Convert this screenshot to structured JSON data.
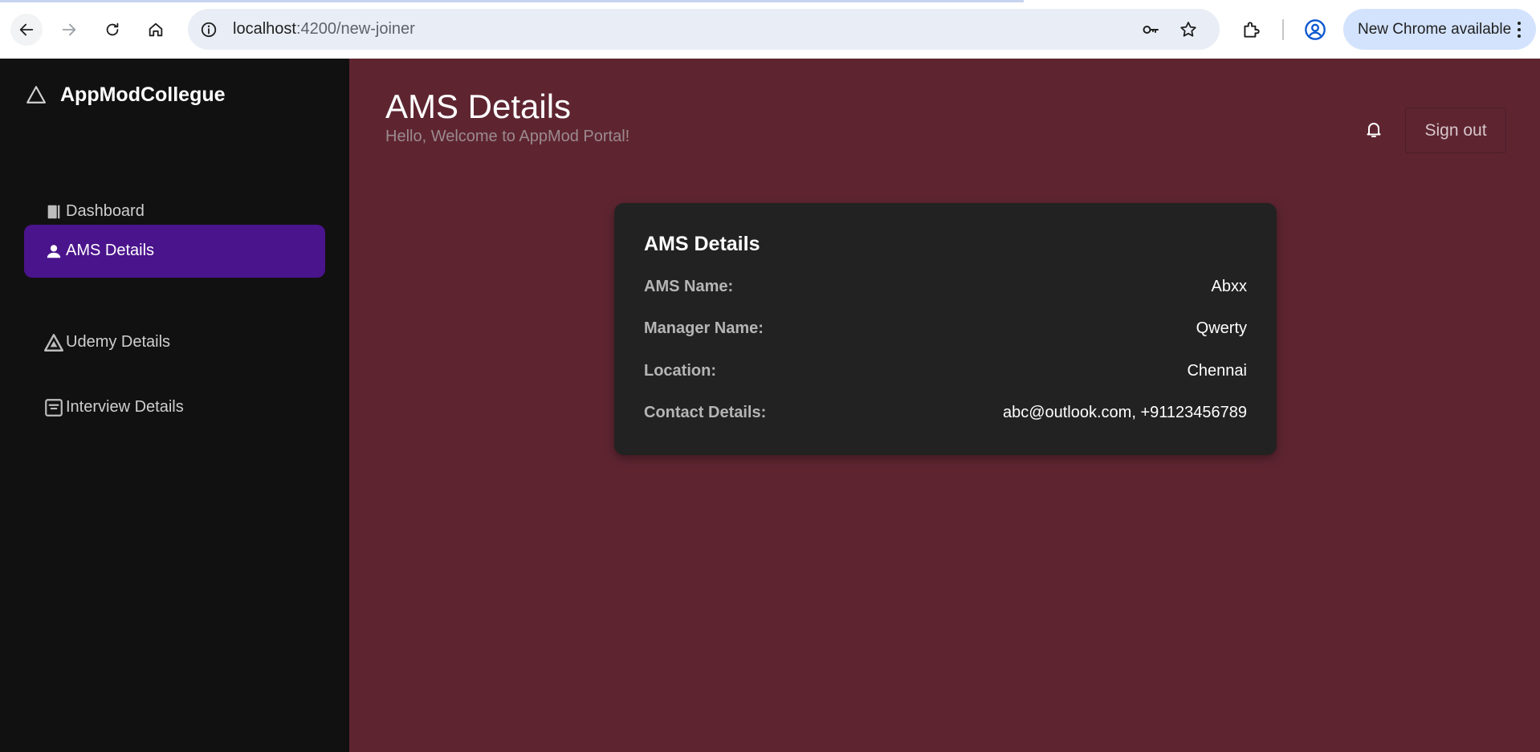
{
  "browser": {
    "url_host": "localhost",
    "url_path": ":4200/new-joiner",
    "update_label": "New Chrome available"
  },
  "app": {
    "brand": "AppModCollegue",
    "nav": [
      {
        "label": "Dashboard",
        "icon": "book-icon",
        "active": false
      },
      {
        "label": "AMS Details",
        "icon": "person-icon",
        "active": true
      },
      {
        "label": "Udemy Details",
        "icon": "triangle-logo-icon",
        "active": false
      },
      {
        "label": "Interview Details",
        "icon": "list-box-icon",
        "active": false
      }
    ]
  },
  "header": {
    "title": "AMS Details",
    "subtitle": "Hello, Welcome to AppMod Portal!",
    "signout_label": "Sign out"
  },
  "card": {
    "title": "AMS Details",
    "rows": [
      {
        "label": "AMS Name:",
        "value": "Abxx"
      },
      {
        "label": "Manager Name:",
        "value": "Qwerty"
      },
      {
        "label": "Location:",
        "value": "Chennai"
      },
      {
        "label": "Contact Details:",
        "value": "abc@outlook.com, +91123456789"
      }
    ]
  },
  "colors": {
    "sidebar_bg": "#111111",
    "main_bg": "#5e2531",
    "active_nav": "#4a148c",
    "card_bg": "#222222"
  }
}
